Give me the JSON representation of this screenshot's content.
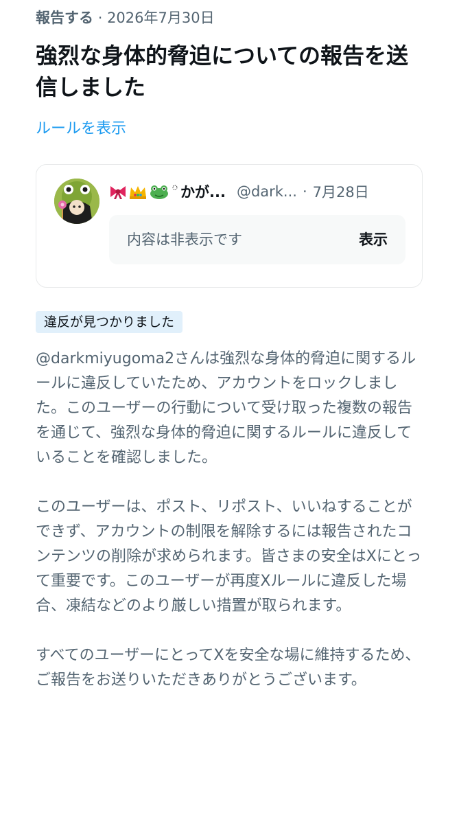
{
  "header": {
    "report_label": "報告する",
    "separator": "·",
    "date": "2026年7月30日"
  },
  "title": "強烈な身体的脅迫についての報告を送信しました",
  "rules_link": "ルールを表示",
  "reported_post": {
    "display_name": "🎀👑🐸*かが...",
    "emoji_icons": [
      "ribbon-icon",
      "crown-icon",
      "frog-icon"
    ],
    "name_text": "かが...",
    "handle": "@dark...",
    "separator": "·",
    "date": "7月28日",
    "hidden_text": "内容は非表示です",
    "show_label": "表示"
  },
  "badge": "違反が見つかりました",
  "paragraphs": [
    "@darkmiyugoma2さんは強烈な身体的脅迫に関するルールに違反していたため、アカウントをロックしました。このユーザーの行動について受け取った複数の報告を通じて、強烈な身体的脅迫に関するルールに違反していることを確認しました。",
    "このユーザーは、ポスト、リポスト、いいねすることができず、アカウントの制限を解除するには報告されたコンテンツの削除が求められます。皆さまの安全はXにとって重要です。このユーザーが再度Xルールに違反した場合、凍結などのより厳しい措置が取られます。",
    "すべてのユーザーにとってXを安全な場に維持するため、ご報告をお送りいただきありがとうございます。"
  ],
  "colors": {
    "link": "#1d9bf0",
    "muted": "#536471",
    "text": "#0f1419",
    "badge_bg": "#e1f0fb"
  }
}
